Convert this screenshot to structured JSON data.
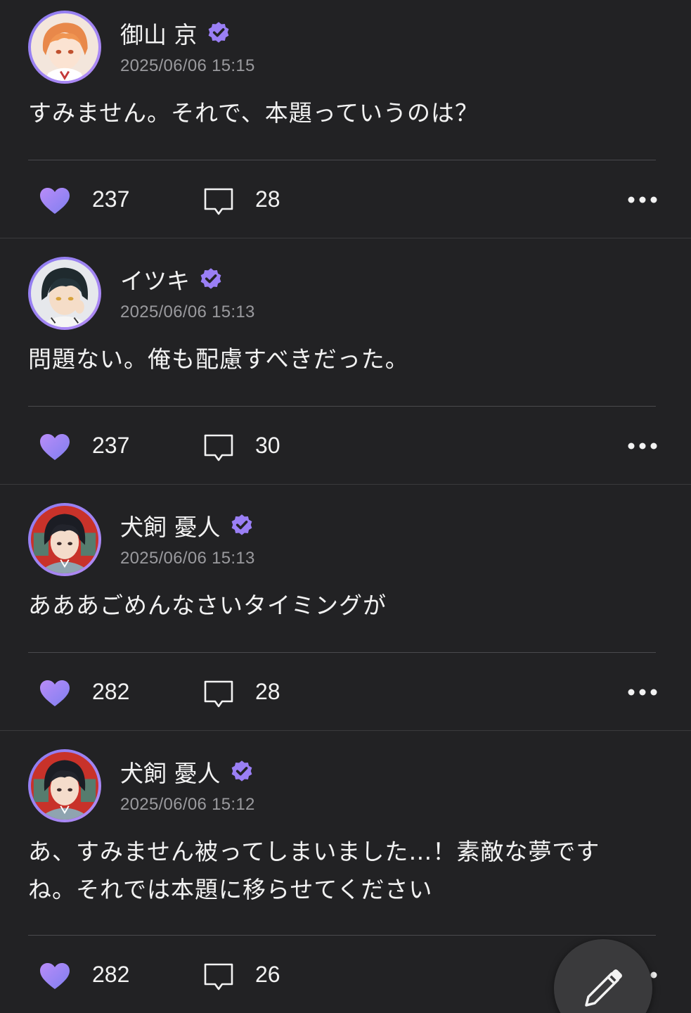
{
  "colors": {
    "background": "#222224",
    "accent": "#9a7ff5",
    "heart_gradient": [
      "#b98cf8",
      "#7f7ff0"
    ],
    "text": "#f2f2f2",
    "muted": "#9a9a9e"
  },
  "posts": [
    {
      "author": "御山 京",
      "verified": true,
      "timestamp": "2025/06/06 15:15",
      "body_lines": [
        "すみません。それで、本題っていうのは？"
      ],
      "likes": "237",
      "comments": "28",
      "avatar_icon": "orange-hair-character-avatar"
    },
    {
      "author": "イツキ",
      "verified": true,
      "timestamp": "2025/06/06 15:13",
      "body_lines": [
        "問題ない。俺も配慮すべきだった。"
      ],
      "likes": "237",
      "comments": "30",
      "avatar_icon": "dark-hair-character-avatar"
    },
    {
      "author": "犬飼 憂人",
      "verified": true,
      "timestamp": "2025/06/06 15:13",
      "body_lines": [
        "あああごめんなさいタイミングが"
      ],
      "likes": "282",
      "comments": "28",
      "avatar_icon": "red-background-character-avatar"
    },
    {
      "author": "犬飼 憂人",
      "verified": true,
      "timestamp": "2025/06/06 15:12",
      "body_lines": [
        "あ、すみません被ってしまいました…！素敵な夢です",
        "ね。それでは本題に移らせてください"
      ],
      "likes": "282",
      "comments": "26",
      "avatar_icon": "red-background-character-avatar"
    }
  ],
  "fab": {
    "icon": "pencil-icon"
  }
}
